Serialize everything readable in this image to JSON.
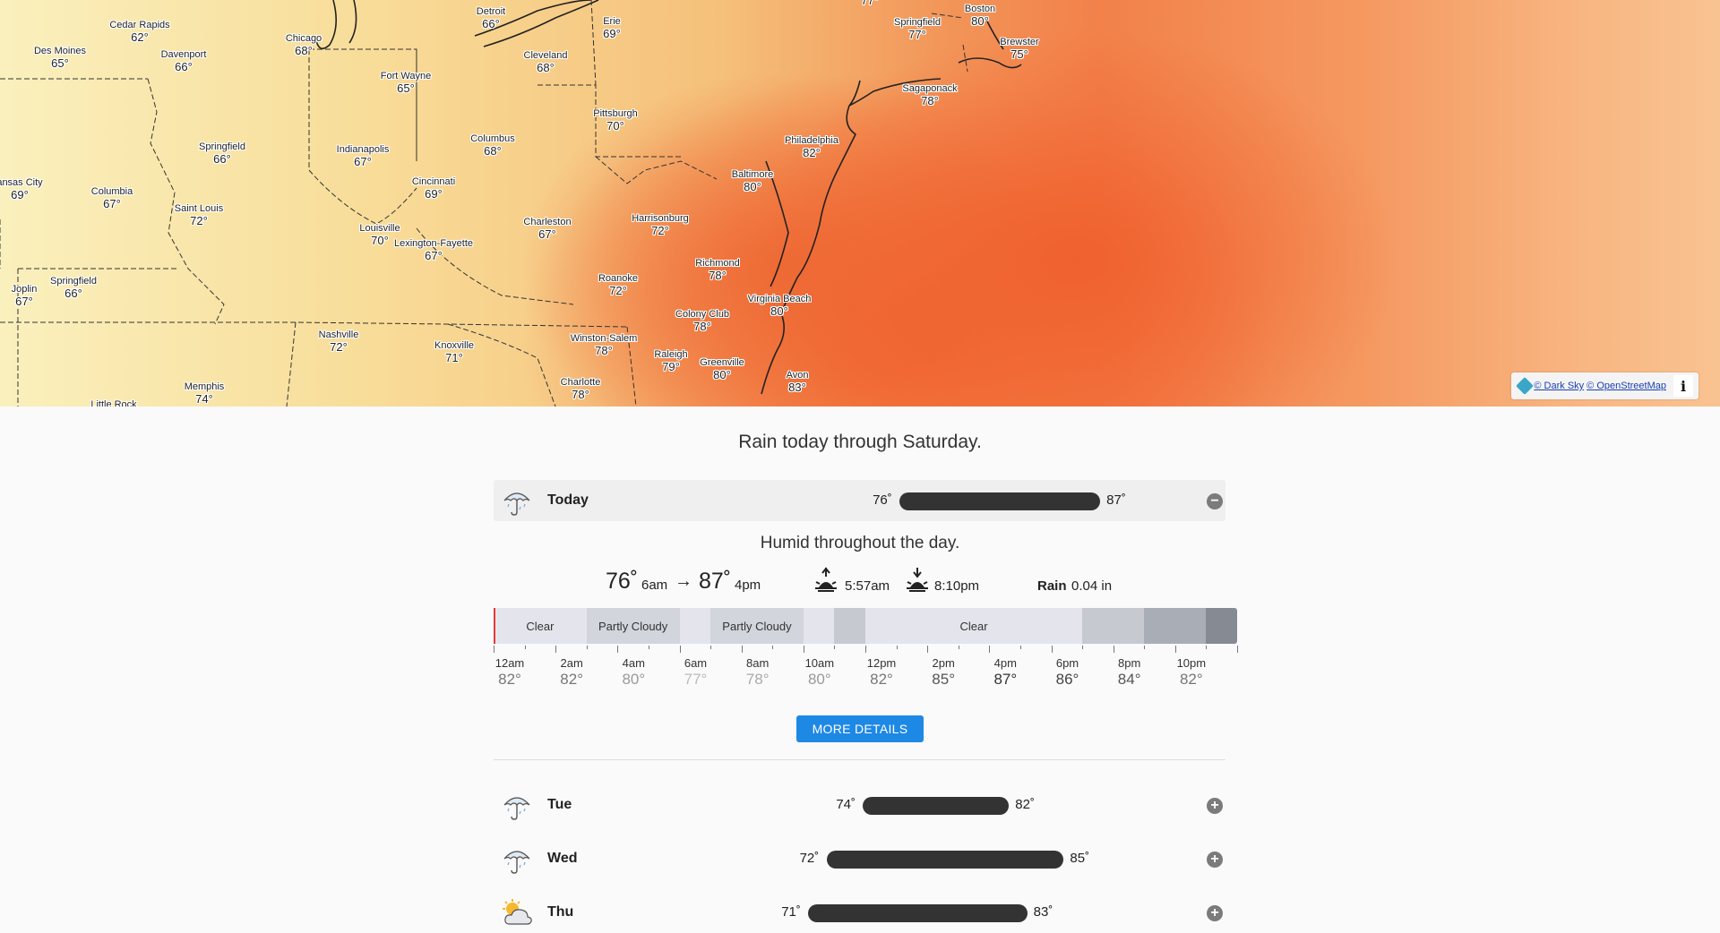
{
  "map": {
    "cities": [
      {
        "name": "Cedar Rapids",
        "temp": "62°"
      },
      {
        "name": "Des Moines",
        "temp": "65°"
      },
      {
        "name": "Davenport",
        "temp": "66°"
      },
      {
        "name": "Chicago",
        "temp": "68°"
      },
      {
        "name": "Detroit",
        "temp": "66°"
      },
      {
        "name": "Erie",
        "temp": "69°"
      },
      {
        "name": "Cleveland",
        "temp": "68°"
      },
      {
        "name": "Fort Wayne",
        "temp": "65°"
      },
      {
        "name": "Pittsburgh",
        "temp": "70°"
      },
      {
        "name": "Springfield",
        "temp": "77°"
      },
      {
        "name": "Boston",
        "temp": "80°"
      },
      {
        "name": "Brewster",
        "temp": "75°"
      },
      {
        "name": "Sagaponack",
        "temp": "78°"
      },
      {
        "name": "Philadelphia",
        "temp": "82°"
      },
      {
        "name": "Baltimore",
        "temp": "80°"
      },
      {
        "name": "Springfield",
        "temp": "66°"
      },
      {
        "name": "Indianapolis",
        "temp": "67°"
      },
      {
        "name": "Columbus",
        "temp": "68°"
      },
      {
        "name": "Cincinnati",
        "temp": "69°"
      },
      {
        "name": "ansas City",
        "temp": "69°"
      },
      {
        "name": "Columbia",
        "temp": "67°"
      },
      {
        "name": "Saint Louis",
        "temp": "72°"
      },
      {
        "name": "Louisville",
        "temp": "70°"
      },
      {
        "name": "Lexington-Fayette",
        "temp": "67°"
      },
      {
        "name": "Charleston",
        "temp": "67°"
      },
      {
        "name": "Harrisonburg",
        "temp": "72°"
      },
      {
        "name": "Richmond",
        "temp": "78°"
      },
      {
        "name": "Roanoke",
        "temp": "72°"
      },
      {
        "name": "Virginia Beach",
        "temp": "80°"
      },
      {
        "name": "Joplin",
        "temp": "67°"
      },
      {
        "name": "Springfield",
        "temp": "66°"
      },
      {
        "name": "Colony Club",
        "temp": "78°"
      },
      {
        "name": "Nashville",
        "temp": "72°"
      },
      {
        "name": "Knoxville",
        "temp": "71°"
      },
      {
        "name": "Winston-Salem",
        "temp": "78°"
      },
      {
        "name": "Raleigh",
        "temp": "79°"
      },
      {
        "name": "Greenville",
        "temp": "80°"
      },
      {
        "name": "Avon",
        "temp": "83°"
      },
      {
        "name": "Charlotte",
        "temp": "78°"
      },
      {
        "name": "Memphis",
        "temp": "74°"
      },
      {
        "name": "Little Rock",
        "temp": ""
      },
      {
        "name": "",
        "temp": "77°"
      }
    ],
    "attribution": {
      "darksky": "© Dark Sky",
      "osm": "© OpenStreetMap",
      "info": "i"
    }
  },
  "summary": "Rain today through Saturday.",
  "today": {
    "name": "Today",
    "icon": "rain-umbrella-icon",
    "low": "76˚",
    "high": "87˚",
    "low_value": 76,
    "high_value": 87,
    "toggle": "−",
    "detail_summary": "Humid throughout the day.",
    "stats": {
      "low_temp": "76˚",
      "low_time": "6am",
      "arrow": "→",
      "high_temp": "87˚",
      "high_time": "4pm",
      "sunrise": "5:57am",
      "sunset": "8:10pm",
      "rain_label": "Rain",
      "rain_value": "0.04 in"
    },
    "timeline": [
      {
        "label": "Clear",
        "span_hours": 3,
        "color": "#e4e5ec"
      },
      {
        "label": "Partly Cloudy",
        "span_hours": 3,
        "color": "#d3d5dc"
      },
      {
        "label": "",
        "span_hours": 1,
        "color": "#e4e5ec"
      },
      {
        "label": "Partly Cloudy",
        "span_hours": 3,
        "color": "#d3d5dc"
      },
      {
        "label": "",
        "span_hours": 1,
        "color": "#e4e5ec"
      },
      {
        "label": "",
        "span_hours": 1,
        "color": "#c7c9d0"
      },
      {
        "label": "Clear",
        "span_hours": 7,
        "color": "#e4e5ec"
      },
      {
        "label": "",
        "span_hours": 2,
        "color": "#c7c9d0"
      },
      {
        "label": "",
        "span_hours": 2,
        "color": "#a9adb5"
      },
      {
        "label": "",
        "span_hours": 1,
        "color": "#858a93"
      }
    ],
    "hours": [
      {
        "time": "12am",
        "temp": "82°",
        "color": "#777"
      },
      {
        "time": "2am",
        "temp": "82°",
        "color": "#777"
      },
      {
        "time": "4am",
        "temp": "80°",
        "color": "#999"
      },
      {
        "time": "6am",
        "temp": "77°",
        "color": "#bbb"
      },
      {
        "time": "8am",
        "temp": "78°",
        "color": "#aaa"
      },
      {
        "time": "10am",
        "temp": "80°",
        "color": "#999"
      },
      {
        "time": "12pm",
        "temp": "82°",
        "color": "#777"
      },
      {
        "time": "2pm",
        "temp": "85°",
        "color": "#555"
      },
      {
        "time": "4pm",
        "temp": "87°",
        "color": "#333"
      },
      {
        "time": "6pm",
        "temp": "86°",
        "color": "#444"
      },
      {
        "time": "8pm",
        "temp": "84°",
        "color": "#555"
      },
      {
        "time": "10pm",
        "temp": "82°",
        "color": "#777"
      }
    ],
    "more_details": "MORE DETAILS"
  },
  "days": [
    {
      "name": "Tue",
      "icon": "rain-umbrella-icon",
      "low": "74˚",
      "high": "82˚",
      "low_value": 74,
      "high_value": 82,
      "toggle": "+"
    },
    {
      "name": "Wed",
      "icon": "rain-umbrella-icon",
      "low": "72˚",
      "high": "85˚",
      "low_value": 72,
      "high_value": 85,
      "toggle": "+"
    },
    {
      "name": "Thu",
      "icon": "partly-cloudy-day-icon",
      "low": "71˚",
      "high": "83˚",
      "low_value": 71,
      "high_value": 83,
      "toggle": "+"
    }
  ],
  "week_range": {
    "min": 65,
    "max": 92
  }
}
